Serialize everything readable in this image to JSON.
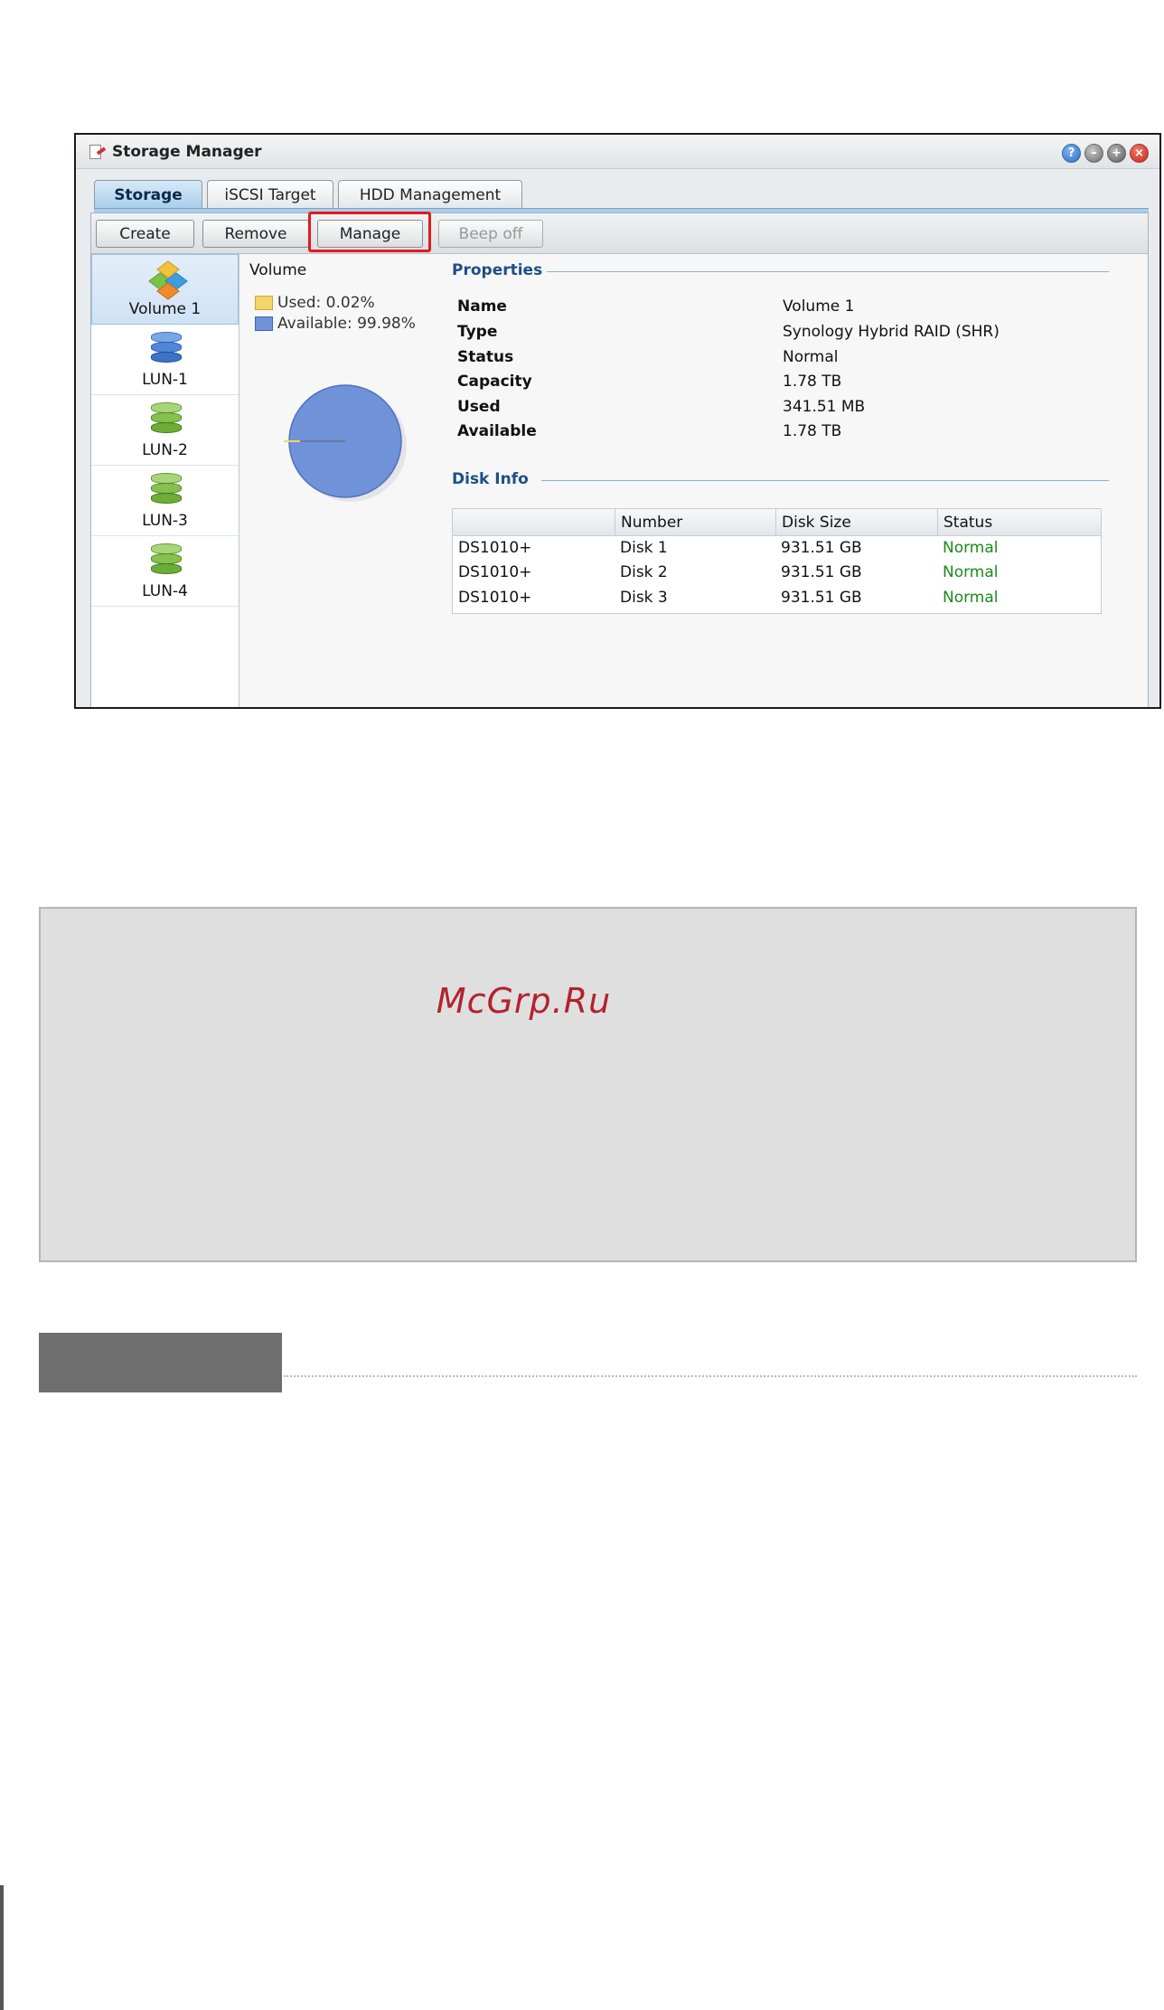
{
  "window": {
    "title": "Storage Manager",
    "controls": [
      "help-icon",
      "minimize-icon",
      "maximize-icon",
      "close-icon"
    ]
  },
  "tabs": [
    {
      "label": "Storage",
      "active": true
    },
    {
      "label": "iSCSI Target",
      "active": false
    },
    {
      "label": "HDD Management",
      "active": false
    }
  ],
  "toolbar": {
    "create_label": "Create",
    "remove_label": "Remove",
    "manage_label": "Manage",
    "beep_off_label": "Beep off"
  },
  "sidebar": {
    "items": [
      {
        "label": "Volume 1",
        "icon": "volume-icon",
        "selected": true
      },
      {
        "label": "LUN-1",
        "icon": "database-blue-icon",
        "selected": false
      },
      {
        "label": "LUN-2",
        "icon": "database-green-icon",
        "selected": false
      },
      {
        "label": "LUN-3",
        "icon": "database-green-icon",
        "selected": false
      },
      {
        "label": "LUN-4",
        "icon": "database-green-icon",
        "selected": false
      }
    ]
  },
  "volume": {
    "title": "Volume",
    "used_label": "Used: 0.02%",
    "available_label": "Available: 99.98%",
    "used_fraction": 0.0002,
    "available_fraction": 0.9998,
    "used_color": "#f5d66b",
    "available_color": "#6f92d8"
  },
  "properties": {
    "title": "Properties",
    "rows": [
      {
        "label": "Name",
        "value": "Volume 1"
      },
      {
        "label": "Type",
        "value": "Synology Hybrid RAID (SHR)"
      },
      {
        "label": "Status",
        "value": "Normal"
      },
      {
        "label": "Capacity",
        "value": "1.78 TB"
      },
      {
        "label": "Used",
        "value": "341.51 MB"
      },
      {
        "label": "Available",
        "value": "1.78 TB"
      }
    ]
  },
  "disk_info": {
    "title": "Disk Info",
    "headers": [
      "",
      "Number",
      "Disk Size",
      "Status"
    ],
    "rows": [
      [
        "DS1010+",
        "Disk 1",
        "931.51 GB",
        "Normal"
      ],
      [
        "DS1010+",
        "Disk 2",
        "931.51 GB",
        "Normal"
      ],
      [
        "DS1010+",
        "Disk 3",
        "931.51 GB",
        "Normal"
      ]
    ],
    "status_color": "#1c8a1c"
  },
  "note": {
    "watermark": "McGrp.Ru"
  },
  "colors": {
    "highlight": "#e21b1b",
    "section_title": "#1d4f86",
    "header_block": "#6f6e6e"
  }
}
